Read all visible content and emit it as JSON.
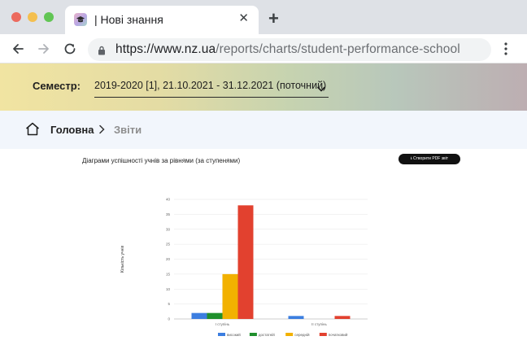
{
  "browser": {
    "tab_title": "| Нові знання",
    "tab_close": "✕",
    "new_tab": "+",
    "url_host": "https://www.nz.ua",
    "url_path": "/reports/charts/student-performance-school"
  },
  "semester": {
    "label": "Семестр:",
    "value": "2019-2020 [1], 21.10.2021 - 31.12.2021 (поточний)"
  },
  "breadcrumb": {
    "home": "Головна",
    "current": "Звіти"
  },
  "page": {
    "title": "Діаграми успішності учнів за рівнями (за ступенями)",
    "pdf_button": "Створити PDF звіт"
  },
  "colors": {
    "high": "#3c7ee0",
    "sufficient": "#1f8f2c",
    "medium": "#f2b100",
    "initial": "#e2412f"
  },
  "chart_data": {
    "type": "bar",
    "title": "",
    "xlabel": "",
    "ylabel": "Кількість учнів",
    "categories": [
      "I ступінь",
      "II ступінь"
    ],
    "series": [
      {
        "name": "високий",
        "color": "#3c7ee0",
        "values": [
          2,
          1
        ]
      },
      {
        "name": "достатній",
        "color": "#1f8f2c",
        "values": [
          2,
          0
        ]
      },
      {
        "name": "середній",
        "color": "#f2b100",
        "values": [
          15,
          0
        ]
      },
      {
        "name": "початковий",
        "color": "#e2412f",
        "values": [
          38,
          1
        ]
      }
    ],
    "ylim": [
      0,
      40
    ],
    "yticks": [
      0,
      5,
      10,
      15,
      20,
      25,
      30,
      35,
      40
    ],
    "grid": true,
    "legend": "bottom"
  }
}
